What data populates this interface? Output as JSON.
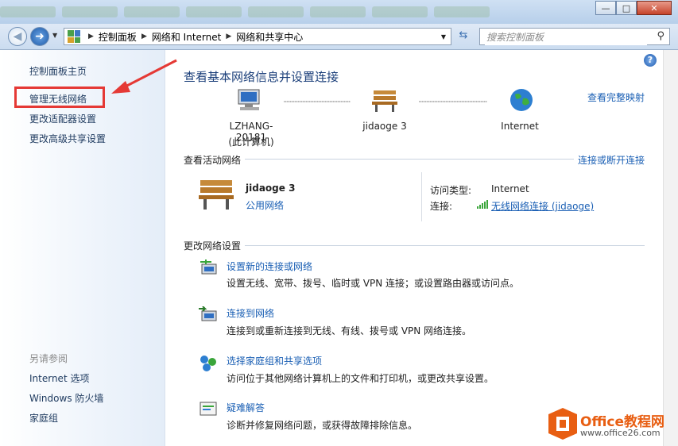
{
  "window": {
    "minimize_glyph": "—",
    "maximize_glyph": "□",
    "close_glyph": "✕"
  },
  "nav": {
    "back_glyph": "◀",
    "forward_glyph": "➜",
    "breadcrumbs": [
      "控制面板",
      "网络和 Internet",
      "网络和共享中心"
    ],
    "search_placeholder": "搜索控制面板"
  },
  "sidebar": {
    "links": [
      "控制面板主页",
      "管理无线网络",
      "更改适配器设置",
      "更改高级共享设置"
    ],
    "see_also_header": "另请参阅",
    "see_also": [
      "Internet 选项",
      "Windows 防火墙",
      "家庭组"
    ]
  },
  "main": {
    "heading": "查看基本网络信息并设置连接",
    "view_full_map": "查看完整映射",
    "nodes": [
      {
        "name": "LZHANG-20181",
        "sub": "(此计算机)"
      },
      {
        "name": "jidaoge  3"
      },
      {
        "name": "Internet"
      }
    ],
    "active_section": {
      "title": "查看活动网络",
      "connect_link": "连接或断开连接",
      "network_name": "jidaoge  3",
      "network_type": "公用网络",
      "access_type_label": "访问类型:",
      "access_type_value": "Internet",
      "connection_label": "连接:",
      "connection_value": "无线网络连接 (jidaoge)"
    },
    "change_section": {
      "title": "更改网络设置",
      "tasks": [
        {
          "link": "设置新的连接或网络",
          "desc": "设置无线、宽带、拨号、临时或 VPN 连接；或设置路由器或访问点。"
        },
        {
          "link": "连接到网络",
          "desc": "连接到或重新连接到无线、有线、拨号或 VPN 网络连接。"
        },
        {
          "link": "选择家庭组和共享选项",
          "desc": "访问位于其他网络计算机上的文件和打印机，或更改共享设置。"
        },
        {
          "link": "疑难解答",
          "desc": "诊断并修复网络问题，或获得故障排除信息。"
        }
      ]
    }
  },
  "watermark": {
    "title": "Office教程网",
    "url": "www.office26.com"
  },
  "colors": {
    "link": "#1a5fb4",
    "heading": "#1b3f7a",
    "highlight": "#e53935",
    "brand": "#e85e12"
  }
}
